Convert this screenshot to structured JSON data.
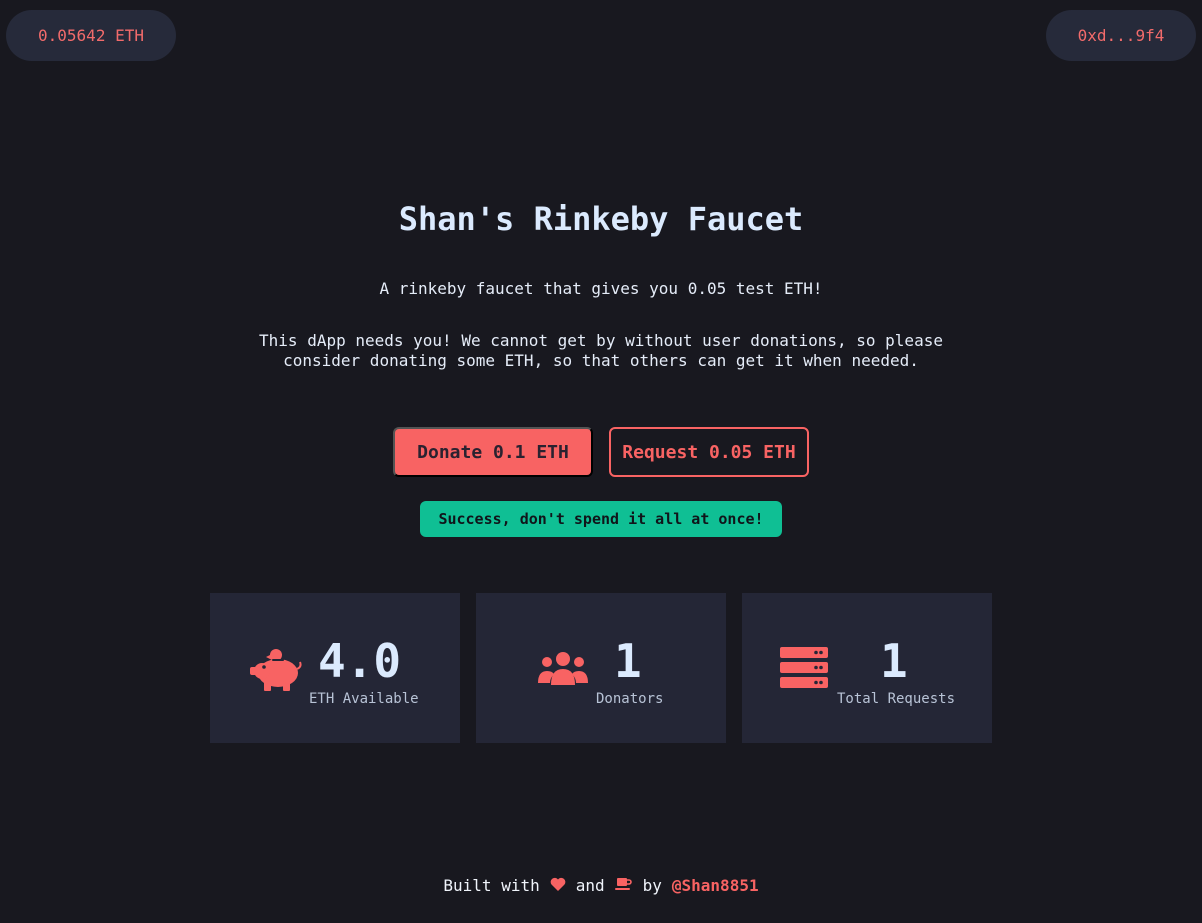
{
  "header": {
    "balance": "0.05642 ETH",
    "address": "0xd...9f4"
  },
  "hero": {
    "title": "Shan's Rinkeby Faucet",
    "tagline": "A rinkeby faucet that gives you 0.05 test ETH!",
    "appeal": "This dApp needs you! We cannot get by without user donations, so please consider donating some ETH, so that others can get it when needed."
  },
  "actions": {
    "donate_label": "Donate 0.1 ETH",
    "request_label": "Request 0.05 ETH"
  },
  "toast": {
    "message": "Success, don't spend it all at once!",
    "color": "#0fbf94"
  },
  "stats": [
    {
      "icon": "piggy-bank-icon",
      "value": "4.0",
      "label": "ETH Available"
    },
    {
      "icon": "users-icon",
      "value": "1",
      "label": "Donators"
    },
    {
      "icon": "server-icon",
      "value": "1",
      "label": "Total Requests"
    }
  ],
  "footer": {
    "built_with": "Built with",
    "love_icon": "heart-icon",
    "and": "and",
    "coffee_icon": "coffee-icon",
    "by": "by",
    "handle": "@Shan8851"
  },
  "colors": {
    "background": "#18181f",
    "card": "#242636",
    "accent": "#f86363",
    "text": "#dbeafe"
  }
}
